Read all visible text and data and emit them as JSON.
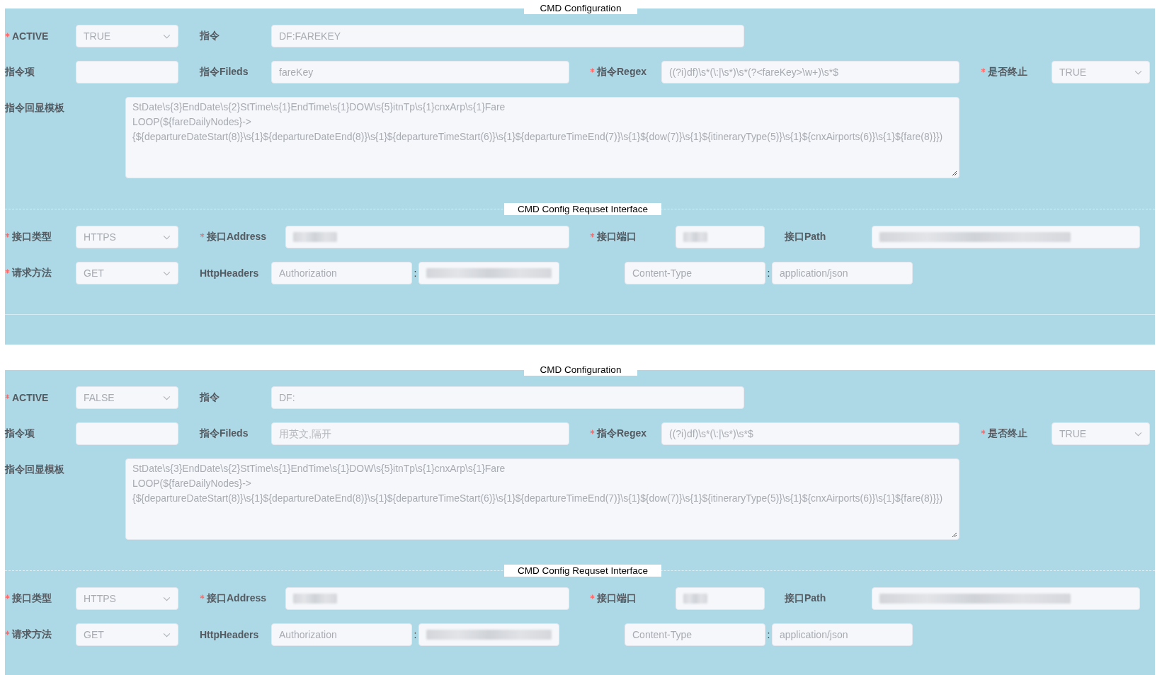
{
  "sections": [
    {
      "config": {
        "legend": "CMD Configuration",
        "active": {
          "label": "ACTIVE",
          "required": true,
          "value": "TRUE"
        },
        "command": {
          "label": "指令",
          "required": false,
          "value": "DF:FAREKEY"
        },
        "command_item": {
          "label": "指令项",
          "required": false
        },
        "fields": {
          "label": "指令Fileds",
          "required": false,
          "value": "fareKey"
        },
        "regex": {
          "label": "指令Regex",
          "required": true,
          "value": "((?i)df)\\s*(\\:|\\s*)\\s*(?<fareKey>\\w+)\\s*$"
        },
        "terminate": {
          "label": "是否终止",
          "required": true,
          "value": "TRUE"
        },
        "template": {
          "label": "指令回显模板",
          "required": false,
          "value": "StDate\\s{3}EndDate\\s{2}StTime\\s{1}EndTime\\s{1}DOW\\s{5}itnTp\\s{1}cnxArp\\s{1}Fare\nLOOP(${fareDailyNodes}->\n{${departureDateStart(8)}\\s{1}${departureDateEnd(8)}\\s{1}${departureTimeStart(6)}\\s{1}${departureTimeEnd(7)}\\s{1}${dow(7)}\\s{1}${itineraryType(5)}\\s{1}${cnxAirports(6)}\\s{1}${fare(8)}})"
        }
      },
      "interface": {
        "legend": "CMD Config Requset Interface",
        "type": {
          "label": "接口类型",
          "required": true,
          "value": "HTTPS"
        },
        "address": {
          "label": "接口Address",
          "required": true,
          "redacted": true
        },
        "port": {
          "label": "接口端口",
          "required": true,
          "redacted": true
        },
        "path": {
          "label": "接口Path",
          "required": false,
          "redacted": true
        },
        "method": {
          "label": "请求方法",
          "required": true,
          "value": "GET"
        },
        "headers": {
          "label": "HttpHeaders",
          "separator": ":",
          "items": [
            {
              "key": "Authorization",
              "redacted": true
            },
            {
              "key": "Content-Type",
              "value": "application/json",
              "redacted": false
            }
          ]
        }
      }
    },
    {
      "config": {
        "legend": "CMD Configuration",
        "active": {
          "label": "ACTIVE",
          "required": true,
          "value": "FALSE"
        },
        "command": {
          "label": "指令",
          "required": false,
          "value": "DF:"
        },
        "command_item": {
          "label": "指令项",
          "required": false
        },
        "fields": {
          "label": "指令Fileds",
          "required": false,
          "placeholder": "用英文,隔开"
        },
        "regex": {
          "label": "指令Regex",
          "required": true,
          "value": "((?i)df)\\s*(\\:|\\s*)\\s*$"
        },
        "terminate": {
          "label": "是否终止",
          "required": true,
          "value": "TRUE"
        },
        "template": {
          "label": "指令回显模板",
          "required": false,
          "value": "StDate\\s{3}EndDate\\s{2}StTime\\s{1}EndTime\\s{1}DOW\\s{5}itnTp\\s{1}cnxArp\\s{1}Fare\nLOOP(${fareDailyNodes}->\n{${departureDateStart(8)}\\s{1}${departureDateEnd(8)}\\s{1}${departureTimeStart(6)}\\s{1}${departureTimeEnd(7)}\\s{1}${dow(7)}\\s{1}${itineraryType(5)}\\s{1}${cnxAirports(6)}\\s{1}${fare(8)}})"
        }
      },
      "interface": {
        "legend": "CMD Config Requset Interface",
        "type": {
          "label": "接口类型",
          "required": true,
          "value": "HTTPS"
        },
        "address": {
          "label": "接口Address",
          "required": true,
          "redacted": true
        },
        "port": {
          "label": "接口端口",
          "required": true,
          "redacted": true
        },
        "path": {
          "label": "接口Path",
          "required": false,
          "redacted": true
        },
        "method": {
          "label": "请求方法",
          "required": true,
          "value": "GET"
        },
        "headers": {
          "label": "HttpHeaders",
          "separator": ":",
          "items": [
            {
              "key": "Authorization",
              "redacted": true
            },
            {
              "key": "Content-Type",
              "value": "application/json",
              "redacted": false
            }
          ]
        }
      }
    }
  ]
}
